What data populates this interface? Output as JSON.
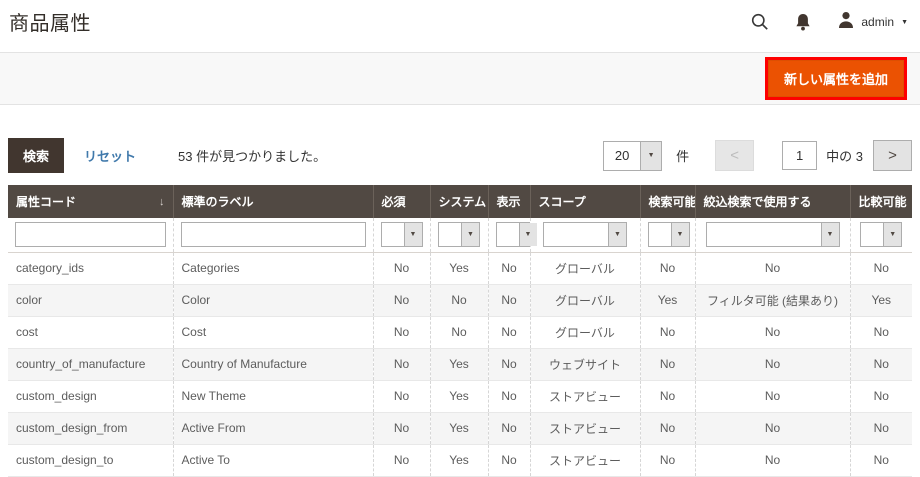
{
  "page": {
    "title": "商品属性"
  },
  "topbar": {
    "username": "admin"
  },
  "toolbar": {
    "add_attribute_button": "新しい属性を追加"
  },
  "filterbar": {
    "search_button": "検索",
    "reset_link": "リセット",
    "records_found": "53 件が見つかりました。"
  },
  "pagination": {
    "per_page": "20",
    "per_page_unit": "件",
    "prev_label": "<",
    "current_page": "1",
    "total_pages_label": "中の 3",
    "next_label": ">"
  },
  "glyphs": {
    "sort_desc": "↓",
    "dropdown_caret": "▼",
    "account_caret": "▼"
  },
  "colors": {
    "accent_orange": "#eb5202",
    "highlight_red": "#fe0000",
    "table_header_bg": "#514943",
    "search_button_bg": "#41362f",
    "link_blue": "#4079ab",
    "zebra_row": "#f5f5f5",
    "toolbar_band": "#f8f8f8"
  },
  "table": {
    "columns": [
      "属性コード",
      "標準のラベル",
      "必須",
      "システム",
      "表示",
      "スコープ",
      "検索可能",
      "絞込検索で使用する",
      "比較可能"
    ],
    "rows": [
      [
        "category_ids",
        "Categories",
        "No",
        "Yes",
        "No",
        "グローバル",
        "No",
        "No",
        "No"
      ],
      [
        "color",
        "Color",
        "No",
        "No",
        "No",
        "グローバル",
        "Yes",
        "フィルタ可能 (結果あり)",
        "Yes"
      ],
      [
        "cost",
        "Cost",
        "No",
        "No",
        "No",
        "グローバル",
        "No",
        "No",
        "No"
      ],
      [
        "country_of_manufacture",
        "Country of Manufacture",
        "No",
        "Yes",
        "No",
        "ウェブサイト",
        "No",
        "No",
        "No"
      ],
      [
        "custom_design",
        "New Theme",
        "No",
        "Yes",
        "No",
        "ストアビュー",
        "No",
        "No",
        "No"
      ],
      [
        "custom_design_from",
        "Active From",
        "No",
        "Yes",
        "No",
        "ストアビュー",
        "No",
        "No",
        "No"
      ],
      [
        "custom_design_to",
        "Active To",
        "No",
        "Yes",
        "No",
        "ストアビュー",
        "No",
        "No",
        "No"
      ]
    ]
  }
}
